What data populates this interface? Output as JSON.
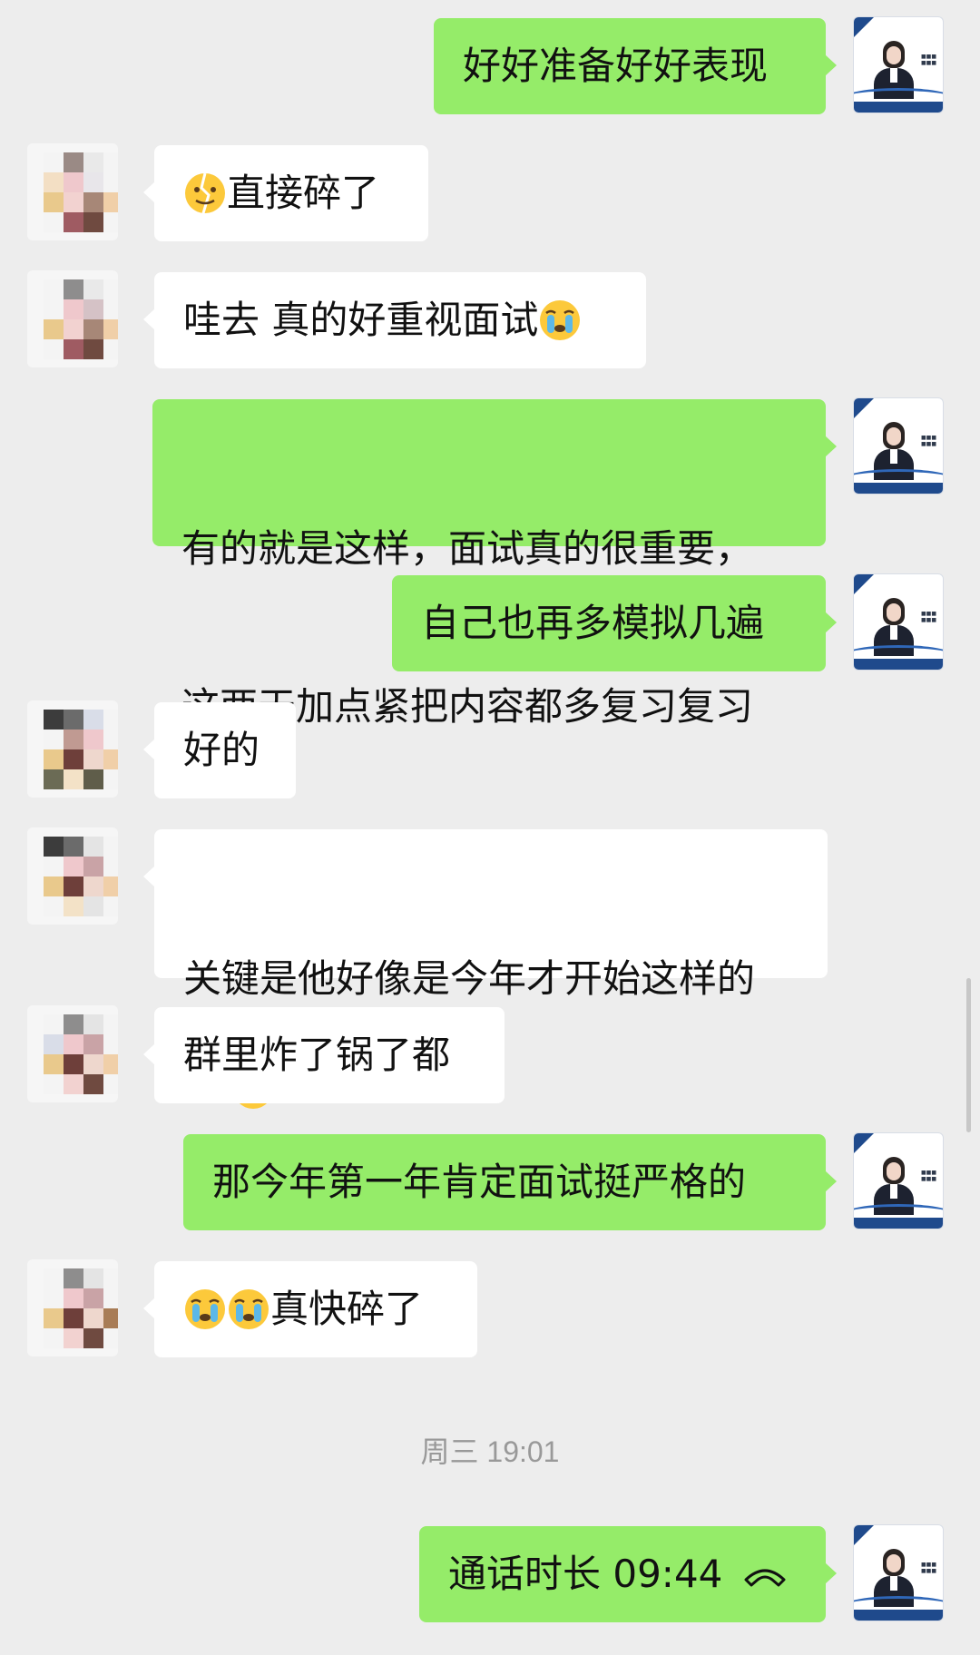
{
  "messages": [
    {
      "side": "out",
      "text": "好好准备好好表现"
    },
    {
      "side": "in",
      "text": "直接碎了",
      "emoji": "broken-heart-face-emoji"
    },
    {
      "side": "in",
      "text": "哇去 真的好重视面试",
      "emoji": "crying-face-emoji"
    },
    {
      "side": "out",
      "line1": "有的就是这样，面试真的很重要，",
      "line2": "这两天加点紧把内容都多复习复习"
    },
    {
      "side": "out",
      "text": "自己也再多模拟几遍"
    },
    {
      "side": "in",
      "text": "好的"
    },
    {
      "side": "in",
      "text": "关键是他好像是今年才开始这样的",
      "emoji": "crying-face-emoji"
    },
    {
      "side": "in",
      "text": "群里炸了锅了都"
    },
    {
      "side": "out",
      "text": "那今年第一年肯定面试挺严格的"
    },
    {
      "side": "in",
      "text": "真快碎了",
      "emoji": "crying-face-emoji"
    }
  ],
  "timestamp": "周三 19:01",
  "call": {
    "label": "通话时长 09:44",
    "icon": "hang-up-phone-icon"
  },
  "colors": {
    "background": "#ededed",
    "incoming_bubble": "#ffffff",
    "outgoing_bubble": "#95ec69",
    "timestamp": "#999999"
  }
}
